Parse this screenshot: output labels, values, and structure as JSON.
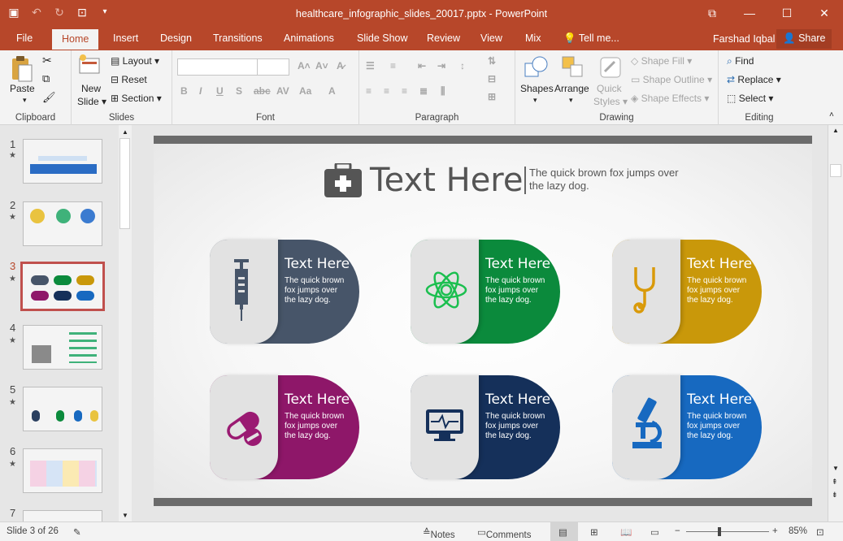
{
  "window": {
    "title": "healthcare_infographic_slides_20017.pptx - PowerPoint"
  },
  "tabs": [
    "File",
    "Home",
    "Insert",
    "Design",
    "Transitions",
    "Animations",
    "Slide Show",
    "Review",
    "View",
    "Mix",
    "Tell me..."
  ],
  "user": "Farshad Iqbal",
  "share_label": "Share",
  "ribbon": {
    "clipboard": {
      "paste": "Paste",
      "label": "Clipboard"
    },
    "slides": {
      "new_slide_line1": "New",
      "new_slide_line2": "Slide",
      "layout": "Layout",
      "reset": "Reset",
      "section": "Section",
      "label": "Slides"
    },
    "font": {
      "label": "Font"
    },
    "paragraph": {
      "label": "Paragraph"
    },
    "drawing": {
      "shapes": "Shapes",
      "arrange": "Arrange",
      "quick_styles_1": "Quick",
      "quick_styles_2": "Styles",
      "shape_fill": "Shape Fill",
      "shape_outline": "Shape Outline",
      "shape_effects": "Shape Effects",
      "label": "Drawing"
    },
    "editing": {
      "find": "Find",
      "replace": "Replace",
      "select": "Select",
      "label": "Editing"
    }
  },
  "thumbnails": [
    "1",
    "2",
    "3",
    "4",
    "5",
    "6",
    "7"
  ],
  "active_slide": 3,
  "slide": {
    "title": "Text Here",
    "subtitle": "The quick brown fox jumps over the lazy dog.",
    "cards": [
      {
        "title": "Text Here",
        "body": "The quick brown fox jumps over the lazy dog.",
        "color": "#475569",
        "icon": "syringe-icon",
        "icon_color": "#475569"
      },
      {
        "title": "Text Here",
        "body": "The quick brown fox jumps over the lazy dog.",
        "color": "#0b8a3c",
        "icon": "atom-icon",
        "icon_color": "#1bbf4f"
      },
      {
        "title": "Text Here",
        "body": "The quick brown fox jumps over the lazy dog.",
        "color": "#c9980a",
        "icon": "stethoscope-icon",
        "icon_color": "#d99a0a"
      },
      {
        "title": "Text Here",
        "body": "The quick brown fox jumps over the lazy dog.",
        "color": "#8e1769",
        "icon": "pill-icon",
        "icon_color": "#9a1a72"
      },
      {
        "title": "Text Here",
        "body": "The quick brown fox jumps over the lazy dog.",
        "color": "#15305a",
        "icon": "monitor-icon",
        "icon_color": "#15305a"
      },
      {
        "title": "Text Here",
        "body": "The quick brown fox jumps over the lazy dog.",
        "color": "#1769c0",
        "icon": "microscope-icon",
        "icon_color": "#1769c0"
      }
    ]
  },
  "status": {
    "slide_info": "Slide 3 of 26",
    "notes": "Notes",
    "comments": "Comments",
    "zoom": "85%"
  }
}
